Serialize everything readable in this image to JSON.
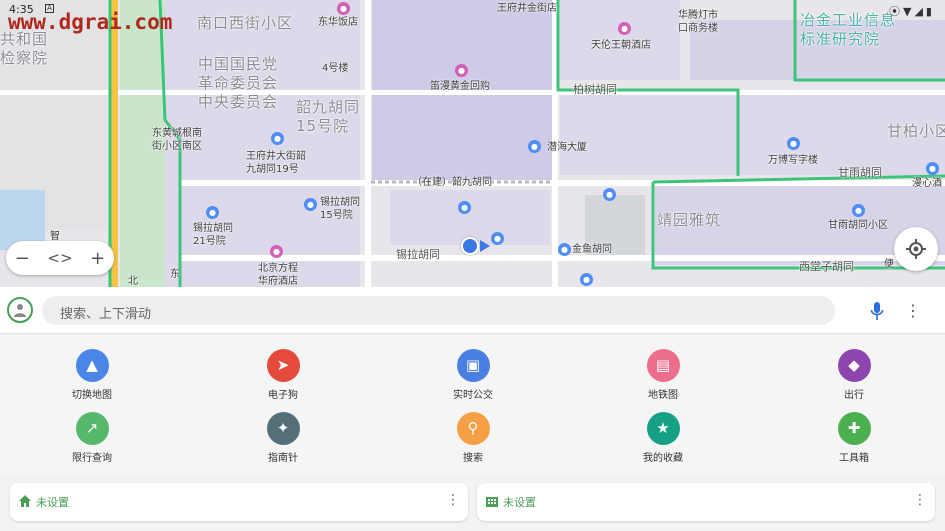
{
  "status": {
    "time": "4:35",
    "notification_icon": "A"
  },
  "watermark": "www.dgrai.com",
  "map": {
    "labels": [
      {
        "text": "共和国\n检察院",
        "cls": "big",
        "l": 0,
        "t": 30
      },
      {
        "text": "南口西街小区",
        "cls": "big",
        "l": 197,
        "t": 14
      },
      {
        "text": "东华饭店",
        "cls": "",
        "l": 318,
        "t": 16
      },
      {
        "text": "王府井金街店",
        "cls": "",
        "l": 497,
        "t": 2
      },
      {
        "text": "华腾灯市\n口商务楼",
        "cls": "",
        "l": 678,
        "t": 9
      },
      {
        "text": "冶金工业信息\n标准研究院",
        "cls": "teal",
        "l": 800,
        "t": 11
      },
      {
        "text": "天伦王朝酒店",
        "cls": "",
        "l": 591,
        "t": 39
      },
      {
        "text": "中国国民党\n革命委员会\n中央委员会",
        "cls": "big",
        "l": 198,
        "t": 55
      },
      {
        "text": "4号楼",
        "cls": "",
        "l": 322,
        "t": 62
      },
      {
        "text": "笛漫黄金回购",
        "cls": "",
        "l": 430,
        "t": 80
      },
      {
        "text": "柏树胡同",
        "cls": "road",
        "l": 573,
        "t": 83
      },
      {
        "text": "韶九胡同\n15号院",
        "cls": "big",
        "l": 296,
        "t": 98
      },
      {
        "text": "甘柏小区",
        "cls": "big",
        "l": 887,
        "t": 122
      },
      {
        "text": "东黄城根南\n街小区南区",
        "cls": "",
        "l": 152,
        "t": 127
      },
      {
        "text": "潜海大厦",
        "cls": "",
        "l": 547,
        "t": 141
      },
      {
        "text": "王府井大街韶\n九胡同19号",
        "cls": "",
        "l": 246,
        "t": 150
      },
      {
        "text": "万博写字楼",
        "cls": "",
        "l": 768,
        "t": 154
      },
      {
        "text": "甘雨胡同",
        "cls": "road",
        "l": 838,
        "t": 166
      },
      {
        "text": "漫心酒",
        "cls": "",
        "l": 912,
        "t": 177
      },
      {
        "text": "（在建）韶九胡同",
        "cls": "",
        "l": 412,
        "t": 176
      },
      {
        "text": "锡拉胡同\n15号院",
        "cls": "",
        "l": 320,
        "t": 196
      },
      {
        "text": "靖园雅筑",
        "cls": "big",
        "l": 657,
        "t": 211
      },
      {
        "text": "锡拉胡同\n21号院",
        "cls": "",
        "l": 193,
        "t": 222
      },
      {
        "text": "甘雨胡同小区",
        "cls": "",
        "l": 828,
        "t": 219
      },
      {
        "text": "智",
        "cls": "",
        "l": 50,
        "t": 230
      },
      {
        "text": "锡拉胡同",
        "cls": "road",
        "l": 396,
        "t": 248
      },
      {
        "text": "金鱼胡同",
        "cls": "",
        "l": 572,
        "t": 243
      },
      {
        "text": "北京方程\n华府酒店",
        "cls": "",
        "l": 258,
        "t": 262
      },
      {
        "text": "西堂子胡同",
        "cls": "road",
        "l": 799,
        "t": 260
      },
      {
        "text": "便",
        "cls": "",
        "l": 884,
        "t": 258
      },
      {
        "text": "北",
        "cls": "",
        "l": 128,
        "t": 275
      },
      {
        "text": "东",
        "cls": "",
        "l": 170,
        "t": 268
      }
    ]
  },
  "zoom": {
    "minus": "−",
    "code": "<>",
    "plus": "+"
  },
  "search": {
    "placeholder": "搜索、上下滑动"
  },
  "grid": [
    {
      "label": "切换地图",
      "color": "#4a86e8",
      "icon": "shapes-icon"
    },
    {
      "label": "电子狗",
      "color": "#e54b3c",
      "icon": "navigation-arrow-icon"
    },
    {
      "label": "实时公交",
      "color": "#4a7fe2",
      "icon": "bus-icon"
    },
    {
      "label": "地铁图",
      "color": "#ec6e8c",
      "icon": "subway-icon"
    },
    {
      "label": "出行",
      "color": "#8e44ad",
      "icon": "directions-icon"
    },
    {
      "label": "限行查询",
      "color": "#57b86a",
      "icon": "trend-icon"
    },
    {
      "label": "指南针",
      "color": "#546e7a",
      "icon": "compass-icon"
    },
    {
      "label": "搜索",
      "color": "#f5a044",
      "icon": "search-icon"
    },
    {
      "label": "我的收藏",
      "color": "#16a085",
      "icon": "star-icon"
    },
    {
      "label": "工具箱",
      "color": "#4caf50",
      "icon": "puzzle-icon"
    }
  ],
  "cards": [
    {
      "label": "未设置",
      "icon": "home-icon"
    },
    {
      "label": "未设置",
      "icon": "company-icon"
    }
  ]
}
